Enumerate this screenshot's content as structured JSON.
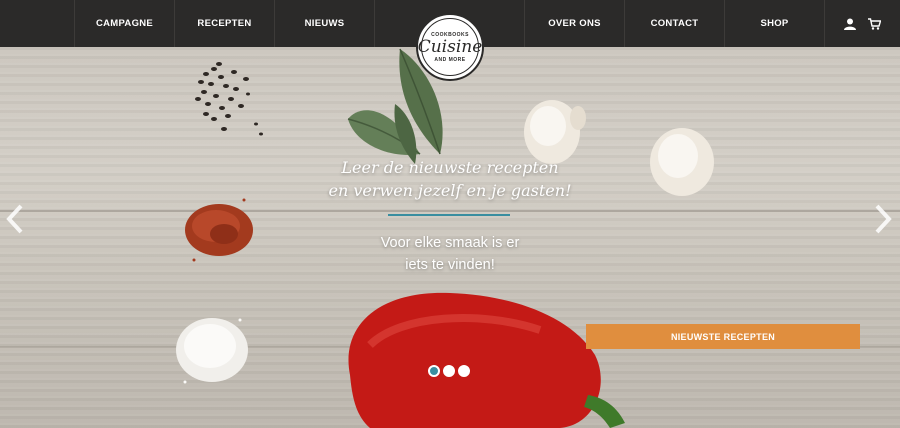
{
  "nav": {
    "items_left": [
      "CAMPAGNE",
      "RECEPTEN",
      "NIEUWS"
    ],
    "items_right": [
      "OVER ONS",
      "CONTACT",
      "SHOP"
    ],
    "icons": [
      "user-icon",
      "cart-icon"
    ]
  },
  "logo": {
    "top_text": "COOKBOOKS",
    "main_text": "Cuisine",
    "bottom_text": "AND MORE"
  },
  "hero": {
    "headline_line1": "Leer de nieuwste recepten",
    "headline_line2": "en verwen jezelf en je gasten!",
    "subline_line1": "Voor elke smaak is er",
    "subline_line2": "iets te vinden!",
    "cta_label": "NIEUWSTE RECEPTEN",
    "accent_color": "#3a8ea0",
    "cta_color": "#e08e3e"
  },
  "slider": {
    "slide_count": 3,
    "active_slide": 1
  }
}
